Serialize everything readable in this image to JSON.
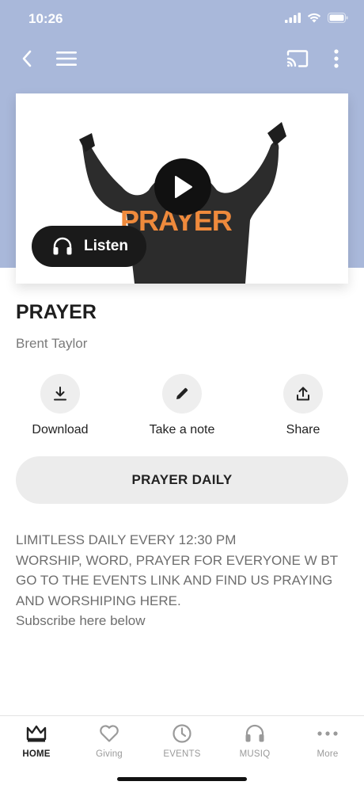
{
  "status_bar": {
    "time": "10:26"
  },
  "media": {
    "artwork_text": "PRAYER",
    "listen_label": "Listen"
  },
  "content": {
    "title": "PRAYER",
    "author": "Brent Taylor"
  },
  "actions": [
    {
      "label": "Download",
      "icon": "download-icon"
    },
    {
      "label": "Take a note",
      "icon": "pencil-icon"
    },
    {
      "label": "Share",
      "icon": "share-icon"
    }
  ],
  "cta": {
    "label": "PRAYER DAILY"
  },
  "description": {
    "lines": [
      "LIMITLESS DAILY EVERY 12:30 PM",
      "WORSHIP, WORD, PRAYER FOR EVERYONE W BT",
      "GO TO THE EVENTS LINK AND FIND US PRAYING",
      "AND WORSHIPING HERE.",
      "Subscribe here below"
    ]
  },
  "tabs": [
    {
      "label": "HOME",
      "icon": "crown-icon",
      "active": true
    },
    {
      "label": "Giving",
      "icon": "heart-icon",
      "active": false
    },
    {
      "label": "EVENTS",
      "icon": "clock-icon",
      "active": false
    },
    {
      "label": "MUSIQ",
      "icon": "headphones-icon",
      "active": false
    },
    {
      "label": "More",
      "icon": "more-icon",
      "active": false
    }
  ],
  "colors": {
    "header_background": "#a9b8da",
    "artwork_accent": "#ef8a3c",
    "button_dark": "#1a1a1a",
    "inactive_tab": "#9a9a9a"
  }
}
